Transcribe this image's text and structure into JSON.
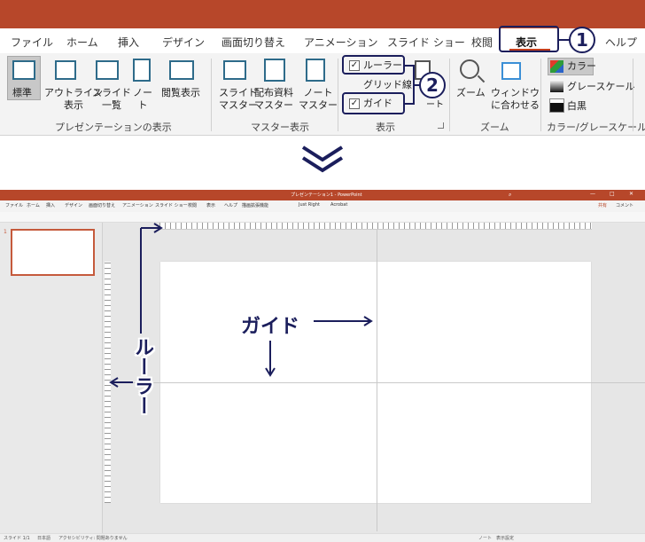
{
  "ribbon": {
    "tabs": [
      "ファイル",
      "ホーム",
      "挿入",
      "デザイン",
      "画面切り替え",
      "アニメーション",
      "スライド ショー",
      "校閲",
      "表示",
      "ヘルプ"
    ],
    "active_tab": "表示",
    "groups": {
      "presentation_views": {
        "label": "プレゼンテーションの表示",
        "buttons": [
          "標準",
          "アウトライン\n表示",
          "スライド\n一覧",
          "ノー\nト",
          "閲覧表示"
        ]
      },
      "master_views": {
        "label": "マスター表示",
        "buttons": [
          "スライド\nマスター",
          "配布資料\nマスター",
          "ノート\nマスター"
        ]
      },
      "show": {
        "label": "表示",
        "ruler": "ルーラー",
        "gridlines": "グリッド線",
        "guides": "ガイド",
        "notes": "ノ\nート"
      },
      "zoom": {
        "label": "ズーム",
        "buttons": [
          "ズーム",
          "ウィンドウ\nに合わせる"
        ]
      },
      "color": {
        "label": "カラー/グレースケール",
        "buttons": [
          "カラー",
          "グレースケール",
          "白黒"
        ]
      }
    },
    "callouts": [
      "1",
      "2"
    ],
    "colors": {
      "title_bar": "#b7472a",
      "callout": "#1b1e5c",
      "accent_underline": "#c43e1c"
    }
  },
  "arrow": "down-chevron",
  "screenshot": {
    "title": "プレゼンテーション1 - PowerPoint",
    "menu": [
      "ファイル",
      "ホーム",
      "挿入",
      "デザイン",
      "画面切り替え",
      "アニメーション",
      "スライド ショー",
      "校閲",
      "表示",
      "ヘルプ",
      "描画拡張機能",
      "Just Right",
      "Acrobat"
    ],
    "share": "共有",
    "comment": "コメント",
    "slide_number": "1",
    "status": [
      "スライド 1/1",
      "日本語",
      "アクセシビリティ: 問題ありません"
    ],
    "status_right": [
      "ノート",
      "表示設定"
    ]
  },
  "annotations": {
    "guide": "ガイド",
    "ruler": "ルーラー"
  }
}
